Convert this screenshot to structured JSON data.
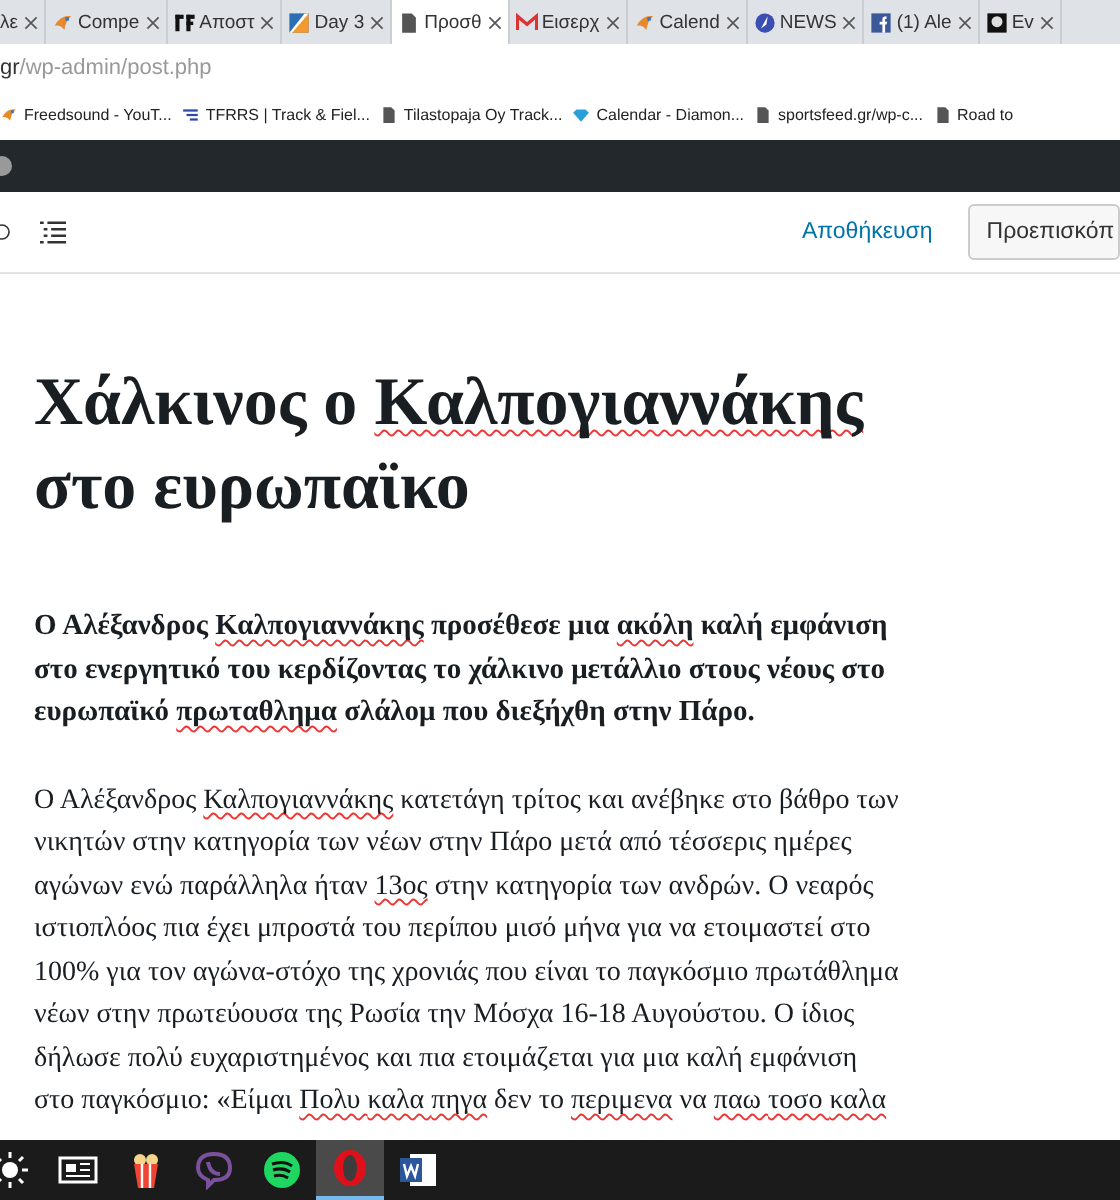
{
  "tabs": [
    {
      "label": "λε",
      "selected": false
    },
    {
      "label": "Compe",
      "selected": false
    },
    {
      "label": "Αποστ",
      "selected": false
    },
    {
      "label": "Day 3",
      "selected": false
    },
    {
      "label": "Προσθ",
      "selected": true
    },
    {
      "label": "Εισερχ",
      "selected": false
    },
    {
      "label": "Calend",
      "selected": false
    },
    {
      "label": "NEWS",
      "selected": false
    },
    {
      "label": "(1) Ale",
      "selected": false
    },
    {
      "label": "Ev",
      "selected": false
    }
  ],
  "address": {
    "host": "gr",
    "path": "/wp-admin/post.php"
  },
  "bookmarks": [
    "Freedsound - YouT...",
    "TFRRS | Track & Fiel...",
    "Tilastopaja Oy Track...",
    "Calendar - Diamon...",
    "sportsfeed.gr/wp-c...",
    "Road to"
  ],
  "toolbar": {
    "save": "Αποθήκευση",
    "preview": "Προεπισκόπ"
  },
  "title": [
    [
      {
        "text": "Χάλκινος ο ",
        "misspelled": false
      },
      {
        "text": "Καλπογιαννάκης",
        "misspelled": true
      }
    ],
    [
      {
        "text": "στο ευρωπαϊκο",
        "misspelled": false
      }
    ]
  ],
  "paragraphs": [
    {
      "bold": true,
      "lines": [
        [
          {
            "text": "Ο Αλέξανδρος ",
            "misspelled": false
          },
          {
            "text": "Καλπογιαννάκης",
            "misspelled": true
          },
          {
            "text": " προσέθεσε μια ",
            "misspelled": false
          },
          {
            "text": "ακόλη",
            "misspelled": true
          },
          {
            "text": " καλή εμφάνιση",
            "misspelled": false
          }
        ],
        [
          {
            "text": "στο ενεργητικό του κερδίζοντας το χάλκινο μετάλλιο στους νέους στο",
            "misspelled": false
          }
        ],
        [
          {
            "text": "ευρωπαϊκό ",
            "misspelled": false
          },
          {
            "text": "πρωταθλημα",
            "misspelled": true
          },
          {
            "text": " σλάλομ που διεξήχθη στην Πάρο.",
            "misspelled": false
          }
        ]
      ]
    },
    {
      "bold": false,
      "lines": [
        [
          {
            "text": "Ο Αλέξανδρος ",
            "misspelled": false
          },
          {
            "text": "Καλπογιαννάκης",
            "misspelled": true
          },
          {
            "text": " κατετάγη τρίτος και ανέβηκε στο βάθρο των",
            "misspelled": false
          }
        ],
        [
          {
            "text": "νικητών στην κατηγορία των νέων στην Πάρο μετά από τέσσερις ημέρες",
            "misspelled": false
          }
        ],
        [
          {
            "text": "αγώνων ενώ παράλληλα ήταν ",
            "misspelled": false
          },
          {
            "text": "13ος",
            "misspelled": true
          },
          {
            "text": " στην κατηγορία των ανδρών. Ο νεαρός",
            "misspelled": false
          }
        ],
        [
          {
            "text": "ιστιοπλόος πια έχει μπροστά του περίπου μισό μήνα για να ετοιμαστεί στο",
            "misspelled": false
          }
        ],
        [
          {
            "text": "100% για τον αγώνα-στόχο της χρονιάς που είναι το παγκόσμιο πρωτάθλημα",
            "misspelled": false
          }
        ],
        [
          {
            "text": "νέων στην πρωτεύουσα της Ρωσία την Μόσχα 16-18 Αυγούστου. Ο ίδιος",
            "misspelled": false
          }
        ],
        [
          {
            "text": "δήλωσε πολύ ευχαριστημένος και πια ετοιμάζεται για μια καλή εμφάνιση",
            "misspelled": false
          }
        ],
        [
          {
            "text": "στο παγκόσμιο: «Είμαι ",
            "misspelled": false
          },
          {
            "text": "Πολυ ",
            "misspelled": true
          },
          {
            "text": "καλα ",
            "misspelled": true
          },
          {
            "text": "πηγα",
            "misspelled": true
          },
          {
            "text": " δεν το ",
            "misspelled": false
          },
          {
            "text": "περιμενα",
            "misspelled": true
          },
          {
            "text": " να ",
            "misspelled": false
          },
          {
            "text": "παω ",
            "misspelled": true
          },
          {
            "text": "τοσο ",
            "misspelled": true
          },
          {
            "text": "καλα",
            "misspelled": true
          }
        ]
      ]
    }
  ],
  "taskbar": [
    {
      "active": false
    },
    {
      "active": false
    },
    {
      "active": false
    },
    {
      "active": false
    },
    {
      "active": false
    },
    {
      "active": true
    },
    {
      "active": false
    }
  ]
}
